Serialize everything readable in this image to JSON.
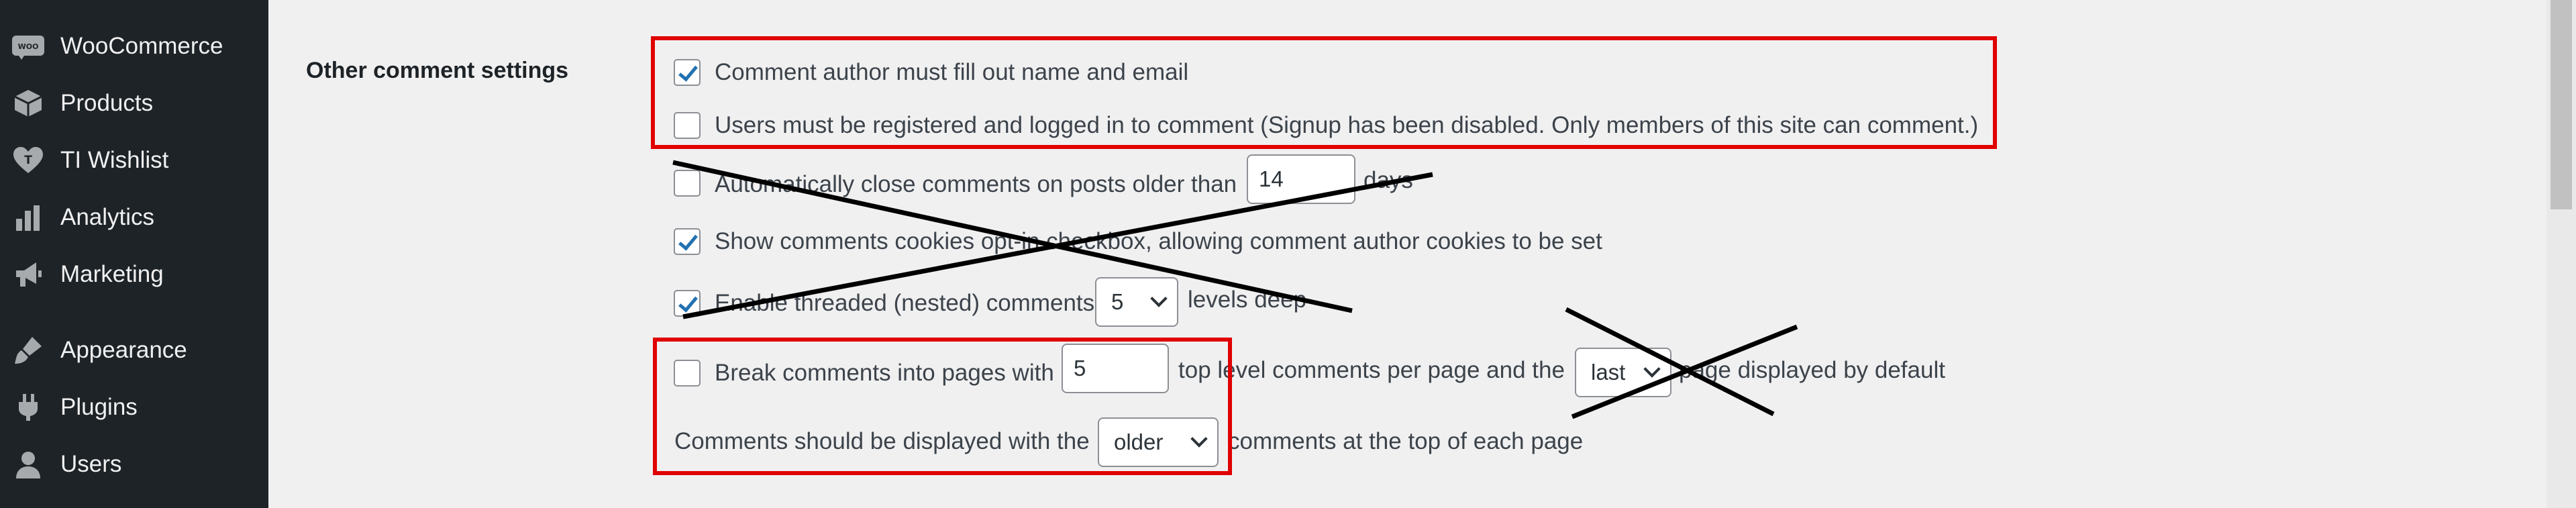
{
  "sidebar": {
    "items": [
      {
        "label": "WooCommerce",
        "icon": "woocommerce-icon"
      },
      {
        "label": "Products",
        "icon": "products-box-icon"
      },
      {
        "label": "TI Wishlist",
        "icon": "wishlist-heart-icon"
      },
      {
        "label": "Analytics",
        "icon": "analytics-bar-chart-icon"
      },
      {
        "label": "Marketing",
        "icon": "megaphone-icon"
      },
      {
        "label": "Appearance",
        "icon": "paintbrush-icon"
      },
      {
        "label": "Plugins",
        "icon": "plugin-plug-icon"
      },
      {
        "label": "Users",
        "icon": "user-icon"
      }
    ],
    "woo_badge": "WOO"
  },
  "settings": {
    "section_label": "Other comment settings",
    "require_name_email": {
      "label": "Comment author must fill out name and email",
      "checked": true
    },
    "registration_required": {
      "label": "Users must be registered and logged in to comment (Signup has been disabled. Only members of this site can comment.)",
      "checked": false
    },
    "close_comments": {
      "label_before": "Automatically close comments on posts older than",
      "value": "14",
      "label_after": "days",
      "checked": false
    },
    "cookies_opt_in": {
      "label": "Show comments cookies opt-in checkbox, allowing comment author cookies to be set",
      "checked": true
    },
    "thread_comments": {
      "label_before": "Enable threaded (nested) comments",
      "depth": "5",
      "label_after": "levels deep",
      "checked": true
    },
    "page_comments": {
      "label_before": "Break comments into pages with",
      "per_page": "5",
      "label_middle": "top level comments per page and the",
      "default_page": "last",
      "label_after": "page displayed by default",
      "checked": false
    },
    "comment_order": {
      "label_before": "Comments should be displayed with the",
      "order": "older",
      "label_after": "comments at the top of each page"
    }
  },
  "colors": {
    "sidebar_bg": "#1d2327",
    "main_bg": "#f0f0f1",
    "checkbox_check": "#2271b1",
    "annotation_red": "#e10000",
    "annotation_strike": "#000000"
  }
}
